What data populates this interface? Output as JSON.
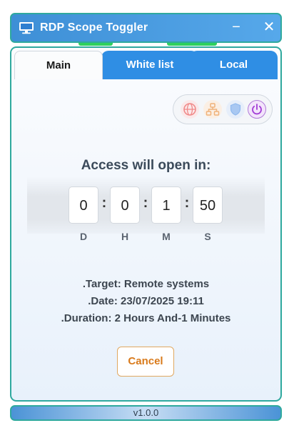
{
  "window": {
    "title": "RDP Scope Toggler",
    "minimize_glyph": "−",
    "close_glyph": "✕"
  },
  "tabs": [
    {
      "label": "Main",
      "active": true
    },
    {
      "label": "White list",
      "active": false
    },
    {
      "label": "Local",
      "active": false
    }
  ],
  "mode_icons": [
    {
      "name": "globe-icon",
      "color": "#f08a8a"
    },
    {
      "name": "network-icon",
      "color": "#f0b27a"
    },
    {
      "name": "shield-icon",
      "color": "#8fb8ee"
    },
    {
      "name": "power-icon",
      "color": "#a23bd6",
      "selected": true
    }
  ],
  "countdown": {
    "heading": "Access will open in:",
    "separator": ":",
    "days": "0",
    "hours": "0",
    "minutes": "1",
    "seconds": "50",
    "unit_days": "D",
    "unit_hours": "H",
    "unit_minutes": "M",
    "unit_seconds": "S"
  },
  "info": {
    "target": ".Target: Remote systems",
    "date": ".Date: 23/07/2025 19:11",
    "duration": ".Duration: 2 Hours And-1 Minutes"
  },
  "cancel_label": "Cancel",
  "status": {
    "version": "v1.0.0"
  },
  "colors": {
    "accent": "#2f8ee4",
    "border": "#2fa99e",
    "cancel": "#d97a1b",
    "indicator": "#2ed05e"
  }
}
